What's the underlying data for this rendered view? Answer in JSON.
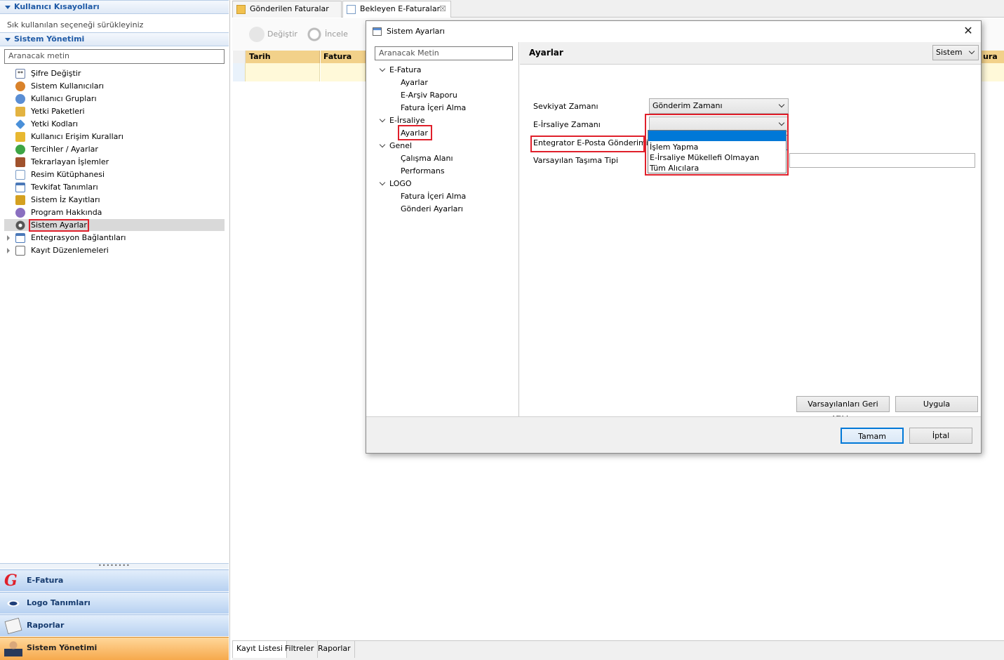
{
  "left_panel": {
    "shortcuts_header": "Kullanıcı Kısayolları",
    "shortcuts_hint": "Sık kullanılan seçeneği sürükleyiniz",
    "system_header": "Sistem Yönetimi",
    "search_placeholder": "Aranacak metin",
    "items": [
      {
        "label": "Şifre Değiştir",
        "icon": "password-icon",
        "color": "#6a7fa8"
      },
      {
        "label": "Sistem Kullanıcıları",
        "icon": "users-icon",
        "color": "#d9822b"
      },
      {
        "label": "Kullanıcı Grupları",
        "icon": "user-groups-icon",
        "color": "#5a8ed4"
      },
      {
        "label": "Yetki Paketleri",
        "icon": "permission-package-icon",
        "color": "#e3b341"
      },
      {
        "label": "Yetki Kodları",
        "icon": "key-icon",
        "color": "#4a90d9"
      },
      {
        "label": "Kullanıcı Erişim Kuralları",
        "icon": "access-rule-icon",
        "color": "#e8b830"
      },
      {
        "label": "Tercihler / Ayarlar",
        "icon": "preferences-icon",
        "color": "#3ea545"
      },
      {
        "label": "Tekrarlayan İşlemler",
        "icon": "recurring-icon",
        "color": "#a0522d"
      },
      {
        "label": "Resim Kütüphanesi",
        "icon": "image-library-icon",
        "color": "#7a9cc6"
      },
      {
        "label": "Tevkifat Tanımları",
        "icon": "withholding-icon",
        "color": "#4a78b8"
      },
      {
        "label": "Sistem İz Kayıtları",
        "icon": "audit-log-icon",
        "color": "#d4a020"
      },
      {
        "label": "Program Hakkında",
        "icon": "about-icon",
        "color": "#8a6fc0"
      },
      {
        "label": "Sistem Ayarları",
        "icon": "gear-icon",
        "color": "#555555"
      },
      {
        "label": "Entegrasyon Bağlantıları",
        "icon": "integration-icon",
        "color": "#4a78b8"
      },
      {
        "label": "Kayıt Düzenlemeleri",
        "icon": "record-edit-icon",
        "color": "#6a6a6a"
      }
    ],
    "modules": [
      {
        "label": "E-Fatura",
        "icon": "e-invoice-logo-icon"
      },
      {
        "label": "Logo Tanımları",
        "icon": "eye-logo-icon"
      },
      {
        "label": "Raporlar",
        "icon": "reports-icon"
      },
      {
        "label": "Sistem Yönetimi",
        "icon": "admin-user-icon"
      }
    ]
  },
  "main": {
    "tabs": [
      {
        "label": "Gönderilen Faturalar"
      },
      {
        "label": "Bekleyen E-Faturalar",
        "close": "☒"
      }
    ],
    "toolbar": {
      "edit_label": "Değiştir",
      "inspect_label": "İncele"
    },
    "columns": [
      "Tarih",
      "Fatura Num",
      "ura Du"
    ],
    "bottom_tabs": [
      "Kayıt Listesi",
      "Filtreler",
      "Raporlar"
    ]
  },
  "dialog": {
    "title": "Sistem Ayarları",
    "close": "✕",
    "search_placeholder": "Aranacak Metin",
    "tree": {
      "efatura": "E-Fatura",
      "efatura_items": [
        "Ayarlar",
        "E-Arşiv Raporu",
        "Fatura İçeri Alma"
      ],
      "eirsaliye": "E-İrsaliye",
      "eirsaliye_items": [
        "Ayarlar"
      ],
      "genel": "Genel",
      "genel_items": [
        "Çalışma Alanı",
        "Performans"
      ],
      "logo": "LOGO",
      "logo_items": [
        "Fatura İçeri Alma",
        "Gönderi Ayarları"
      ]
    },
    "panel_title": "Ayarlar",
    "scope_select": "Sistem",
    "fields": {
      "sevkiyat_label": "Sevkiyat Zamanı",
      "sevkiyat_value": "Gönderim Zamanı",
      "irsaliye_label": "E-İrsaliye Zamanı",
      "irsaliye_value": "",
      "eposta_label": "Entegrator E-Posta Gönderimi",
      "eposta_value": "",
      "tasima_label": "Varsayılan Taşıma Tipi",
      "tasima_value": ""
    },
    "dropdown_options": [
      "",
      "İşlem Yapma",
      "E-İrsaliye Mükellefi Olmayan",
      "Tüm Alıcılara"
    ],
    "buttons": {
      "restore_defaults": "Varsayılanları Geri Yükle",
      "apply": "Uygula",
      "ok": "Tamam",
      "cancel": "İptal"
    }
  }
}
